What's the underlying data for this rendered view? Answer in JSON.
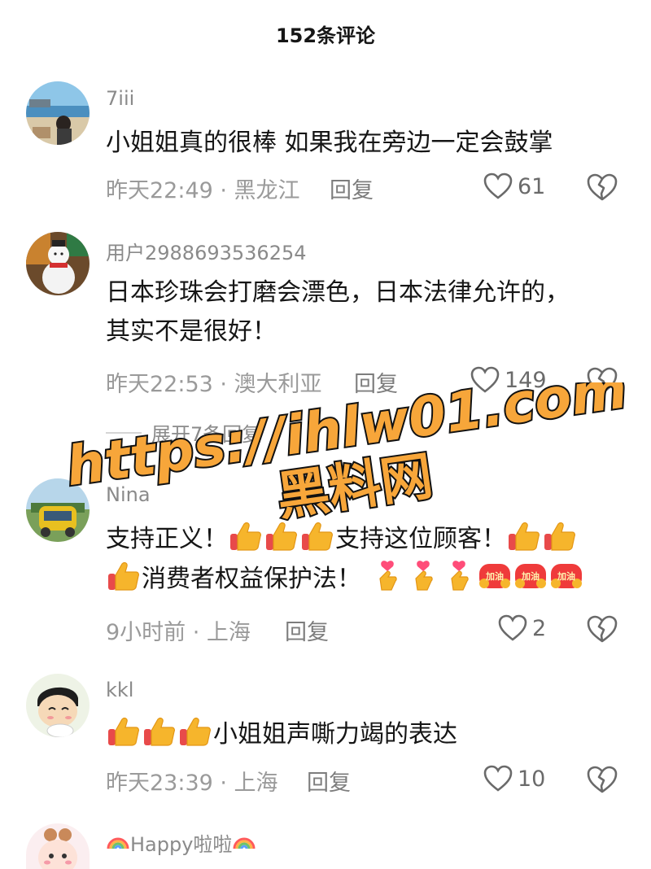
{
  "header": {
    "title": "152条评论"
  },
  "comments": [
    {
      "username": "7iii",
      "text": "小姐姐真的很棒  如果我在旁边一定会鼓掌",
      "meta": "昨天22:49 · 黑龙江",
      "reply_label": "回复",
      "likes": "61"
    },
    {
      "username": "用户2988693536254",
      "text": "日本珍珠会打磨会漂色，日本法律允许的，其实不是很好！",
      "meta": "昨天22:53 · 澳大利亚",
      "reply_label": "回复",
      "likes": "149",
      "expand_label": "展开7条回复"
    },
    {
      "username": "Nina",
      "text_parts": [
        "支持正义！",
        "支持这位顾客！",
        "消费者权益保护法！"
      ],
      "meta": "9小时前 · 上海",
      "reply_label": "回复",
      "likes": "2"
    },
    {
      "username": "kkl",
      "text": "小姐姐声嘶力竭的表达",
      "meta": "昨天23:39 · 上海",
      "reply_label": "回复",
      "likes": "10"
    },
    {
      "username": "Happy啦啦"
    }
  ],
  "emoji_text": {
    "jiayou": "加油"
  },
  "watermark": {
    "line1": "https://ihlw01.com",
    "line2": "黑料网"
  },
  "icons": [
    "heart-icon",
    "broken-heart-icon",
    "thumbs-up-emoji",
    "finger-heart-emoji",
    "jiayou-emoji",
    "rainbow-emoji"
  ],
  "colors": {
    "text": "#161616",
    "meta": "#9a9a9a",
    "watermark_fill": "#f7a63a",
    "watermark_stroke": "#111111"
  }
}
